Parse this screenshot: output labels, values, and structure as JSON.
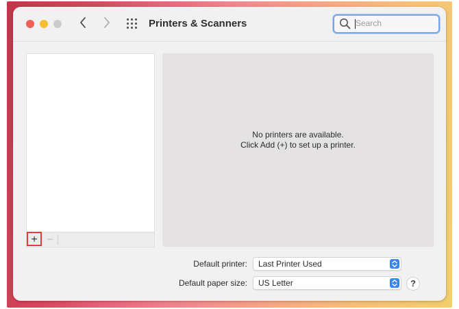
{
  "window": {
    "title": "Printers & Scanners"
  },
  "toolbar": {
    "back_icon": "chevron-left-icon",
    "forward_icon": "chevron-right-icon",
    "grid_icon": "grid-icon",
    "search": {
      "placeholder": "Search",
      "value": ""
    }
  },
  "printer_list": {
    "items": [],
    "add_label": "+",
    "remove_label": "−"
  },
  "detail": {
    "line1": "No printers are available.",
    "line2": "Click Add (+) to set up a printer."
  },
  "defaults": {
    "printer_label": "Default printer:",
    "printer_value": "Last Printer Used",
    "paper_label": "Default paper size:",
    "paper_value": "US Letter"
  },
  "help": {
    "label": "?"
  },
  "colors": {
    "close": "#ee5f58",
    "minimize": "#f6be30",
    "zoom": "#cbcbcb",
    "accent": "#3a86f0",
    "highlight": "#e63b3b"
  }
}
